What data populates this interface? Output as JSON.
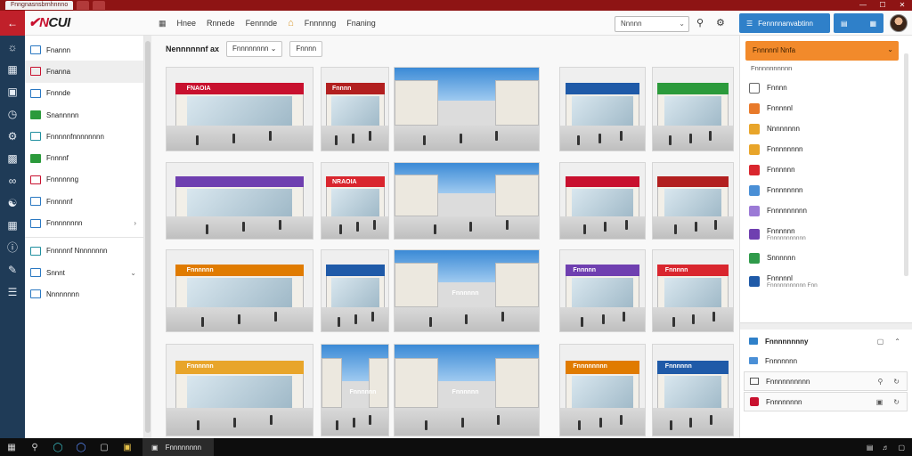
{
  "window": {
    "tabs": [
      "Fnngnasnsbrnhnnno",
      "",
      ""
    ],
    "controls": [
      "—",
      "☐",
      "✕"
    ]
  },
  "header": {
    "logo_prefix": "✔N",
    "logo_text": "CUI",
    "nav": [
      "Hnee",
      "Rnnede",
      "Fennnde",
      "Fnnnnng",
      "Fnaning"
    ],
    "search_value": "Nnnnn",
    "primary_button": "Fennnnanvabtinn",
    "secondary_button": ""
  },
  "sidebar": {
    "items": [
      {
        "label": "Fnannn",
        "icon": "folder-icon",
        "active": false
      },
      {
        "label": "Fnanna",
        "icon": "image-icon",
        "active": true
      },
      {
        "label": "Fnnnde",
        "icon": "list-icon",
        "active": false
      },
      {
        "label": "Snannnnn",
        "icon": "chart-icon",
        "active": false
      },
      {
        "label": "Fnnnnnfnnnnnnnn",
        "icon": "gallery-icon",
        "active": false
      },
      {
        "label": "Fnnnnf",
        "icon": "tag-icon",
        "active": false
      },
      {
        "label": "Fnnnnnng",
        "icon": "store-icon",
        "active": false
      },
      {
        "label": "Fnnnnnf",
        "icon": "document-icon",
        "active": false
      },
      {
        "label": "Fnnnnnnnn",
        "icon": "map-icon",
        "active": false,
        "caret": "›"
      },
      {
        "label": "Fnnnnnf Nnnnnnnn",
        "icon": "share-icon",
        "active": false
      },
      {
        "label": "Snnnt",
        "icon": "settings-icon",
        "active": false,
        "caret": "⌄"
      },
      {
        "label": "Nnnnnnnn",
        "icon": "help-icon",
        "active": false
      }
    ]
  },
  "main": {
    "filter_label": "Nennnnnnf ax",
    "filter_select": "Fnnnnnnnn",
    "filter_button": "Fnnnn",
    "tile_signs": [
      "FNAOIA",
      "Fnnnn",
      "",
      "",
      "",
      "",
      "NRAOIA",
      "",
      "",
      "",
      "Fnnnnnn",
      "",
      "Fnnnnnn",
      "Fnnnnn",
      "Fnnnnn",
      "Fnnnnnn",
      "Fnnnnnn",
      "Fnnnnnn",
      "Fnnnnnnnn",
      "Fnnnnnn"
    ]
  },
  "right_panel": {
    "dropdown": "Fnnnnnl Nnfa",
    "subtitle": "Fnnnnnnnnnn",
    "items": [
      {
        "label": "Fnnnn",
        "sub": "",
        "color": "#ffffff",
        "icon": "checkbox-icon"
      },
      {
        "label": "Fnnnnnl",
        "sub": "",
        "color": "#e87a2a",
        "icon": "person-icon"
      },
      {
        "label": "Nnnnnnnn",
        "sub": "",
        "color": "#e8a52a",
        "icon": "person-icon"
      },
      {
        "label": "Fnnnnnnnn",
        "sub": "",
        "color": "#e8a52a",
        "icon": "person-icon"
      },
      {
        "label": "Fnnnnnn",
        "sub": "",
        "color": "#d9262e",
        "icon": "bookmark-icon"
      },
      {
        "label": "Fnnnnnnnn",
        "sub": "",
        "color": "#4a8fd6",
        "icon": "document-icon"
      },
      {
        "label": "Fnnnnnnnnn",
        "sub": "",
        "color": "#9b7ad6",
        "icon": "grid-icon"
      },
      {
        "label": "Fnnnnnn",
        "sub": "Fnnnnnnnnnnn",
        "color": "#6f3fb0",
        "icon": "gallery-icon"
      },
      {
        "label": "Snnnnnn",
        "sub": "",
        "color": "#2f9a4a",
        "icon": "store-icon"
      },
      {
        "label": "Fnnnnnl",
        "sub": "Fnnnnnnnnnnn Fnn",
        "color": "#1f5aa8",
        "icon": "shield-icon"
      }
    ],
    "footer_title": "Fnnnnnnnny",
    "footer_rows": [
      {
        "label": "Fnnnnnnn",
        "icon": "layers-icon"
      },
      {
        "label": "Fnnnnnnnnnn",
        "icon": "list-icon"
      },
      {
        "label": "Fnnnnnnnn",
        "icon": "record-icon"
      }
    ]
  },
  "taskbar": {
    "app_label": "Fnnnnnnnn"
  },
  "colors": {
    "brand": "#c8102e",
    "rail": "#1f3b57",
    "accent": "#2f80c9",
    "orange": "#f28a2b"
  }
}
